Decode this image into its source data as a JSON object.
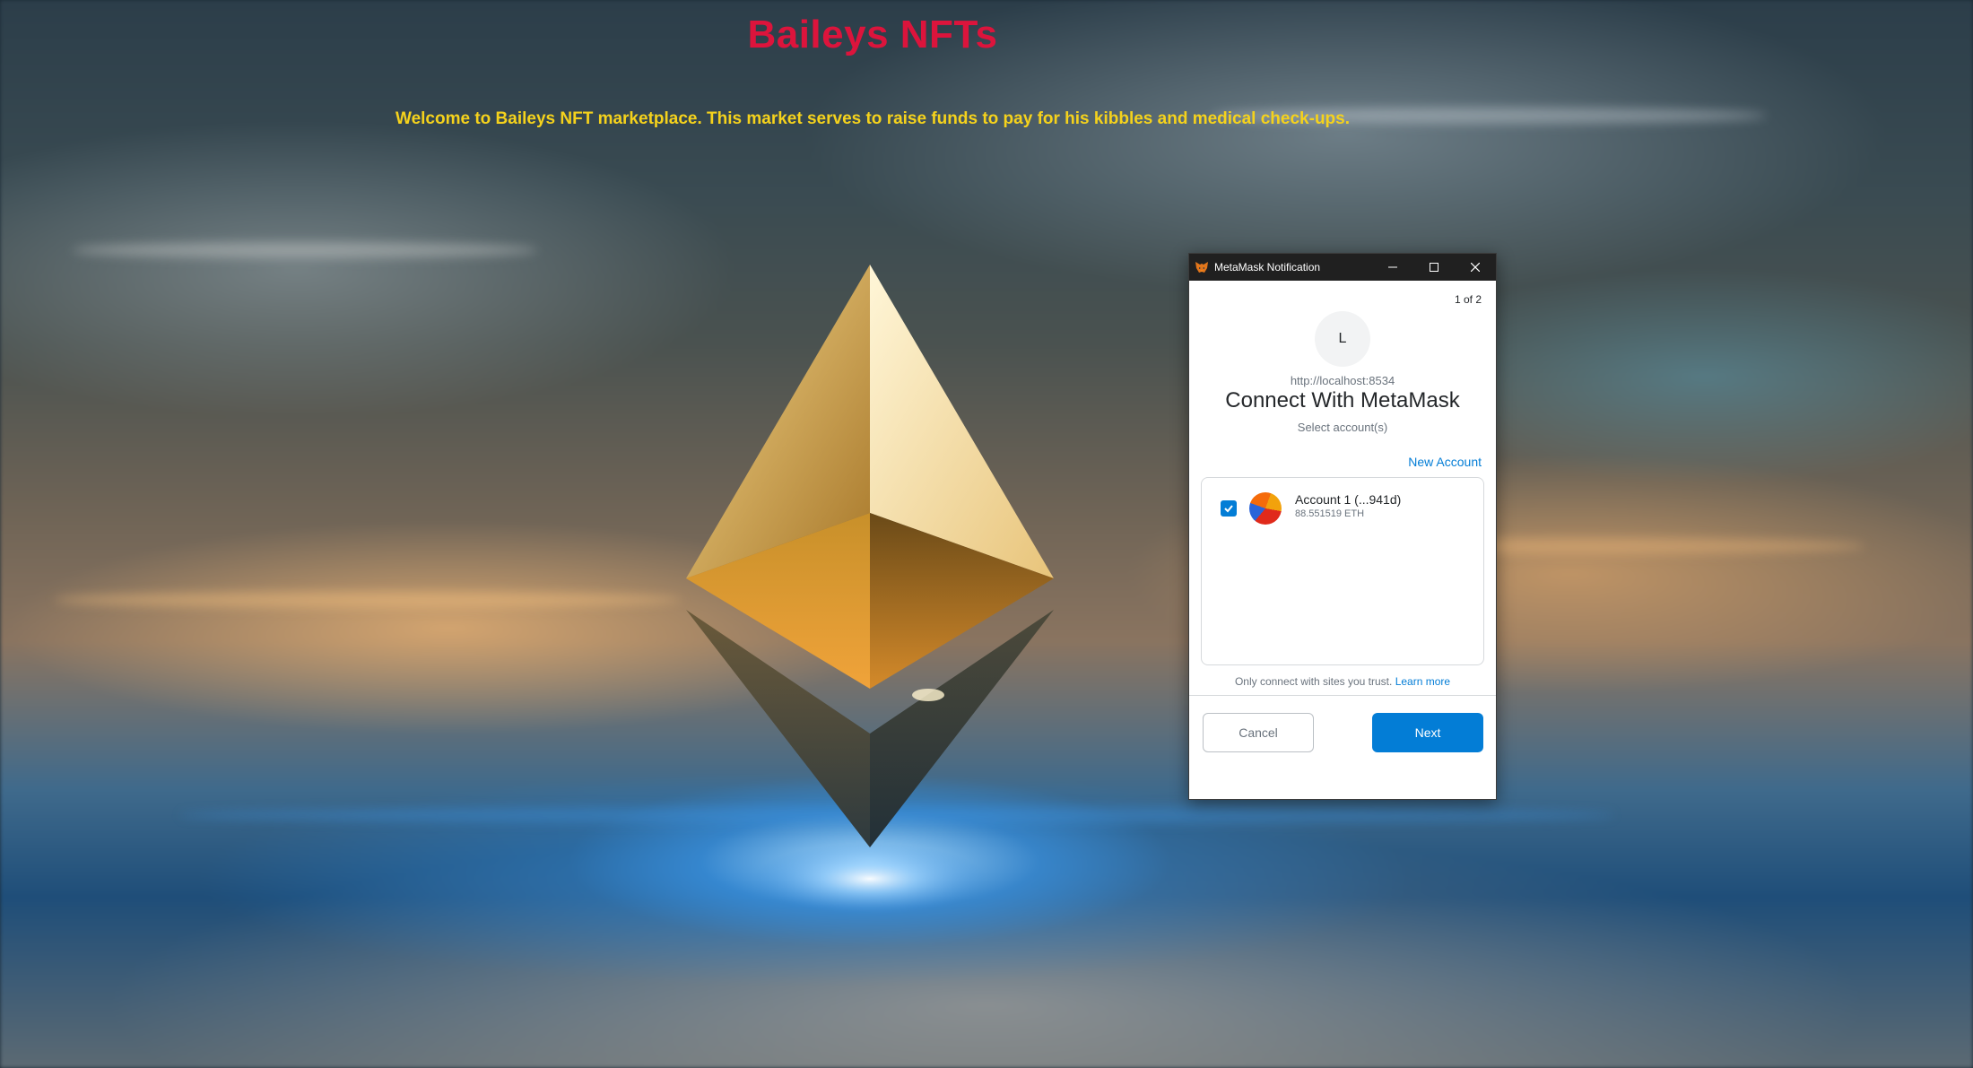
{
  "page": {
    "title": "Baileys NFTs",
    "welcome": "Welcome to Baileys NFT marketplace. This market serves to raise funds to pay for his kibbles and medical check-ups.",
    "title_color": "#dc143c",
    "welcome_color": "#f5d21c"
  },
  "window": {
    "title": "MetaMask Notification",
    "icon": "metamask-fox-icon",
    "controls": [
      "minimize-icon",
      "maximize-icon",
      "close-icon"
    ]
  },
  "metamask": {
    "counter": "1 of 2",
    "site_initial": "L",
    "site_url": "http://localhost:8534",
    "heading": "Connect With MetaMask",
    "subheading": "Select account(s)",
    "new_account": "New Account",
    "accounts": [
      {
        "name": "Account 1 (...941d)",
        "balance": "88.551519 ETH",
        "checked": true
      }
    ],
    "trust_note": "Only connect with sites you trust.",
    "learn_more": "Learn more",
    "cancel_label": "Cancel",
    "next_label": "Next",
    "accent_color": "#037dd6"
  }
}
